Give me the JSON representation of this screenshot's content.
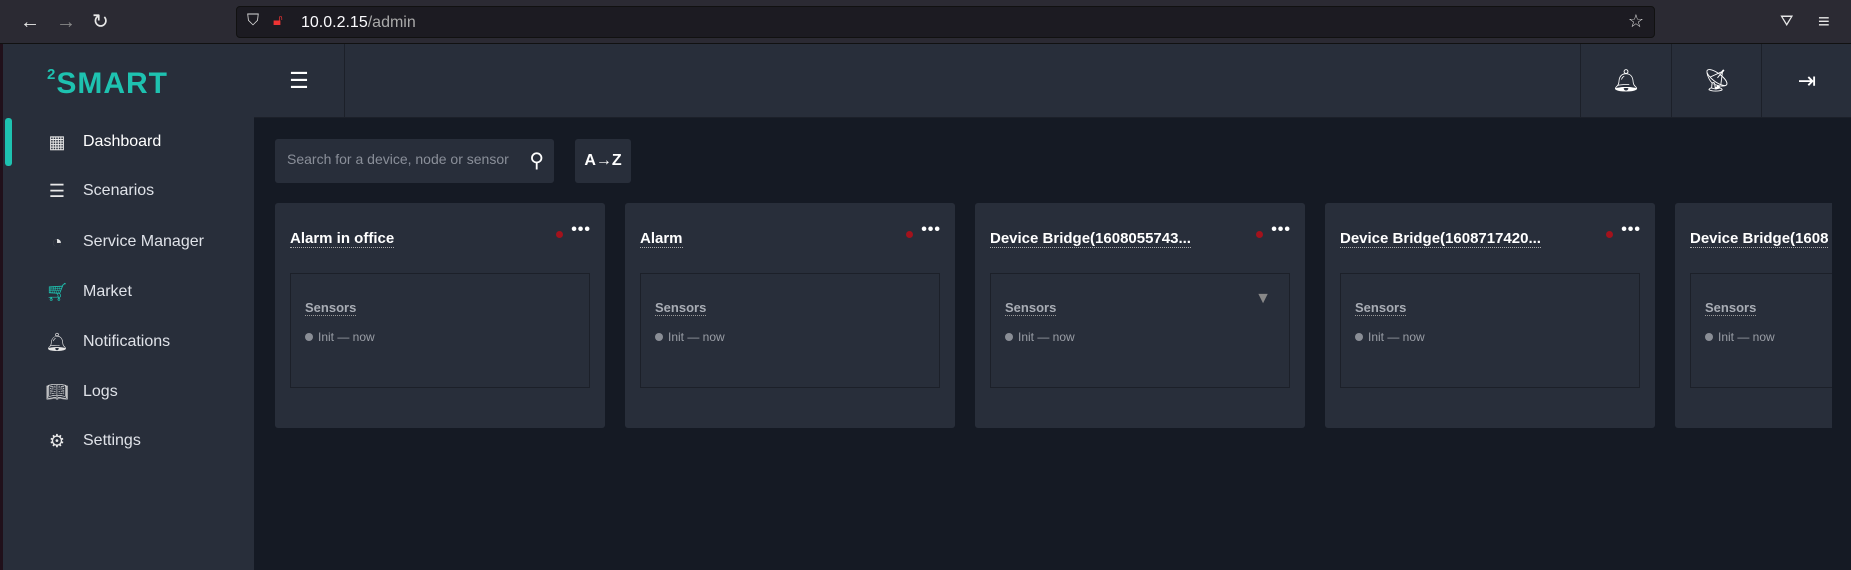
{
  "browser": {
    "url_host": "10.0.2.15",
    "url_path": "/admin"
  },
  "sidebar": {
    "logo": "SMART",
    "logo_sup": "2",
    "items": [
      {
        "label": "Dashboard",
        "icon": "dashboard-icon"
      },
      {
        "label": "Scenarios",
        "icon": "list-icon"
      },
      {
        "label": "Service Manager",
        "icon": "gauge-icon"
      },
      {
        "label": "Market",
        "icon": "cart-icon"
      },
      {
        "label": "Notifications",
        "icon": "bell-icon"
      },
      {
        "label": "Logs",
        "icon": "book-icon"
      },
      {
        "label": "Settings",
        "icon": "gear-icon"
      }
    ]
  },
  "toolbar": {
    "search_placeholder": "Search for a device, node or sensor",
    "sort_label": "A→Z"
  },
  "cards": [
    {
      "title": "Alarm in office",
      "section": "Sensors",
      "status": "Init — now"
    },
    {
      "title": "Alarm",
      "section": "Sensors",
      "status": "Init — now"
    },
    {
      "title": "Device Bridge(1608055743...",
      "section": "Sensors",
      "status": "Init — now"
    },
    {
      "title": "Device Bridge(1608717420...",
      "section": "Sensors",
      "status": "Init — now"
    },
    {
      "title": "Device Bridge(1608",
      "section": "Sensors",
      "status": "Init — now"
    }
  ],
  "colors": {
    "accent": "#1ec2b0",
    "offline": "#a3121c"
  }
}
